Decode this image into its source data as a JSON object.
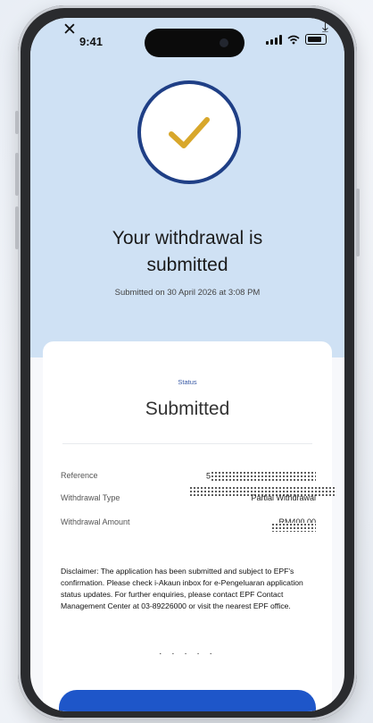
{
  "status_bar": {
    "time": "9:41",
    "close_icon": "close-icon",
    "download_icon": "download-icon"
  },
  "hero": {
    "check_icon": "check-icon",
    "title_line1": "Your withdrawal is",
    "title_line2": "submitted",
    "submitted_on": "Submitted on 30 April 2026 at 3:08 PM"
  },
  "card": {
    "status_label": "Status",
    "status_value": "Submitted",
    "details": [
      {
        "label": "Reference",
        "value": "5"
      },
      {
        "label": "Withdrawal Type",
        "value": "Partial Withdrawal"
      },
      {
        "label": "Withdrawal Amount",
        "value": "RM400.00"
      }
    ],
    "disclaimer": "Disclaimer: The application has been submitted and subject to EPF's confirmation. Please check i-Akaun inbox for e-Pengeluaran application status updates. For further enquiries, please contact EPF Contact Management Center at 03-89226000 or visit the nearest EPF office.",
    "dots": "· · · · ·"
  },
  "colors": {
    "top_background": "#cfe1f4",
    "circle_border": "#1f3f86",
    "check_mark": "#d8a72b",
    "status_label": "#3557a4",
    "primary_button": "#1e56c9"
  }
}
